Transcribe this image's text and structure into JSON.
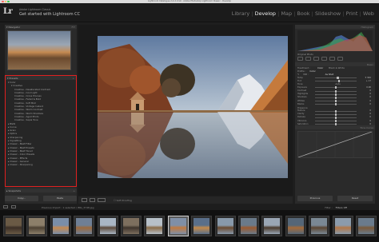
{
  "window": {
    "title": "Lightroom Catalogue-2-2-2.lrcat - Adobe Photoshop Lightroom Classic - Develop"
  },
  "identity": {
    "logo": "Lr",
    "line1": "Adobe Lightroom Classic",
    "line2": "Get started with Lightroom CC"
  },
  "modules": [
    {
      "label": "Library",
      "active": false
    },
    {
      "label": "Develop",
      "active": true
    },
    {
      "label": "Map",
      "active": false
    },
    {
      "label": "Book",
      "active": false
    },
    {
      "label": "Slideshow",
      "active": false
    },
    {
      "label": "Print",
      "active": false
    },
    {
      "label": "Web",
      "active": false
    }
  ],
  "left_panel": {
    "navigator_label": "Navigator",
    "navigator_zoom": "FIT",
    "presets_label": "Presets",
    "presets": [
      {
        "label": "Color",
        "level": 1
      },
      {
        "label": "Creative",
        "level": 2
      },
      {
        "label": "Creative - Desaturated Contrast",
        "level": 3
      },
      {
        "label": "Creative - Cool Light",
        "level": 3
      },
      {
        "label": "Creative - Cross Process",
        "level": 3
      },
      {
        "label": "Creative - Faded & Bold",
        "level": 3
      },
      {
        "label": "Creative - Soft Mist",
        "level": 3
      },
      {
        "label": "Creative - Vintage Instant",
        "level": 3
      },
      {
        "label": "Creative - Warm Contrast",
        "level": 3
      },
      {
        "label": "Creative - Warm Shadows",
        "level": 3
      },
      {
        "label": "Creative - Aged Photo",
        "level": 3
      },
      {
        "label": "Creative - Sepia Tone",
        "level": 3
      },
      {
        "label": "B&W",
        "level": 1
      },
      {
        "label": "Curve",
        "level": 1
      },
      {
        "label": "Grain",
        "level": 1
      },
      {
        "label": "Optics",
        "level": 1
      },
      {
        "label": "Sharpening",
        "level": 1
      },
      {
        "label": "Vignetting",
        "level": 1
      },
      {
        "label": "Classic - B&W Filter",
        "level": 1
      },
      {
        "label": "Classic - B&W Presets",
        "level": 1
      },
      {
        "label": "Classic - B&W Toned",
        "level": 1
      },
      {
        "label": "Classic - Color Presets",
        "level": 1
      },
      {
        "label": "Classic - Effects",
        "level": 1
      },
      {
        "label": "Classic - General",
        "level": 1
      },
      {
        "label": "Classic - Sharpening",
        "level": 1
      }
    ],
    "snapshots_label": "Snapshots",
    "copy_button": "Copy...",
    "paste_button": "Paste"
  },
  "center": {
    "soft_proofing": "Soft Proofing"
  },
  "right_panel": {
    "histogram_label": "Histogram",
    "original_photo": "Original Photo",
    "basic_label": "Basic",
    "treatment": "Treatment :",
    "treatment_color": "Color",
    "treatment_bw": "Black & White",
    "profile_label": "Profile :",
    "profile_value": "Color",
    "wb_label": "WB :",
    "wb_value": "As Shot",
    "sliders_wb": [
      {
        "label": "Temp",
        "value": "5 300",
        "pos": 0.55
      },
      {
        "label": "Tint",
        "value": "+ 17",
        "pos": 0.58
      }
    ],
    "tone_label": "Tone",
    "tone_auto": "Auto",
    "sliders_tone": [
      {
        "label": "Exposure",
        "value": "0.00",
        "pos": 0.5
      },
      {
        "label": "Contrast",
        "value": "0",
        "pos": 0.5
      },
      {
        "label": "Highlights",
        "value": "0",
        "pos": 0.5
      },
      {
        "label": "Shadows",
        "value": "0",
        "pos": 0.5
      },
      {
        "label": "Whites",
        "value": "0",
        "pos": 0.5
      },
      {
        "label": "Blacks",
        "value": "0",
        "pos": 0.5
      }
    ],
    "presence_label": "Presence",
    "sliders_presence": [
      {
        "label": "Texture",
        "value": "0",
        "pos": 0.5
      },
      {
        "label": "Clarity",
        "value": "0",
        "pos": 0.5
      },
      {
        "label": "Dehaze",
        "value": "0",
        "pos": 0.5
      },
      {
        "label": "Vibrance",
        "value": "0",
        "pos": 0.5
      },
      {
        "label": "Saturation",
        "value": "0",
        "pos": 0.5
      }
    ],
    "tone_curve_label": "Tone Curve",
    "previous_button": "Previous",
    "reset_button": "Reset"
  },
  "filmstrip": {
    "info": "Previous Import : 1 selected / IMG_3748.jpg",
    "filter_label": "Filter :",
    "filter_value": "Filters Off",
    "selected_index": 7,
    "thumb_colors": [
      [
        "#6a5a45",
        "#3b2f26"
      ],
      [
        "#8c7f6a",
        "#4d4234"
      ],
      [
        "#7a8ea8",
        "#c58a52"
      ],
      [
        "#6f7f95",
        "#9c6a3e"
      ],
      [
        "#a9b6c4",
        "#5c4a3b"
      ],
      [
        "#7d6f5e",
        "#3e342c"
      ],
      [
        "#b7c0c8",
        "#8a6c48"
      ],
      [
        "#7f8fa6",
        "#c07a40"
      ],
      [
        "#5a6f8a",
        "#c48a4a"
      ],
      [
        "#8899aa",
        "#6a4a30"
      ],
      [
        "#6a7a8a",
        "#9a5a30"
      ],
      [
        "#9aa6b4",
        "#4a3a2c"
      ],
      [
        "#556677",
        "#a56b38"
      ],
      [
        "#7a8894",
        "#5b4633"
      ],
      [
        "#8b9bab",
        "#b27748"
      ],
      [
        "#6a7b8c",
        "#7a5a3a"
      ]
    ]
  }
}
